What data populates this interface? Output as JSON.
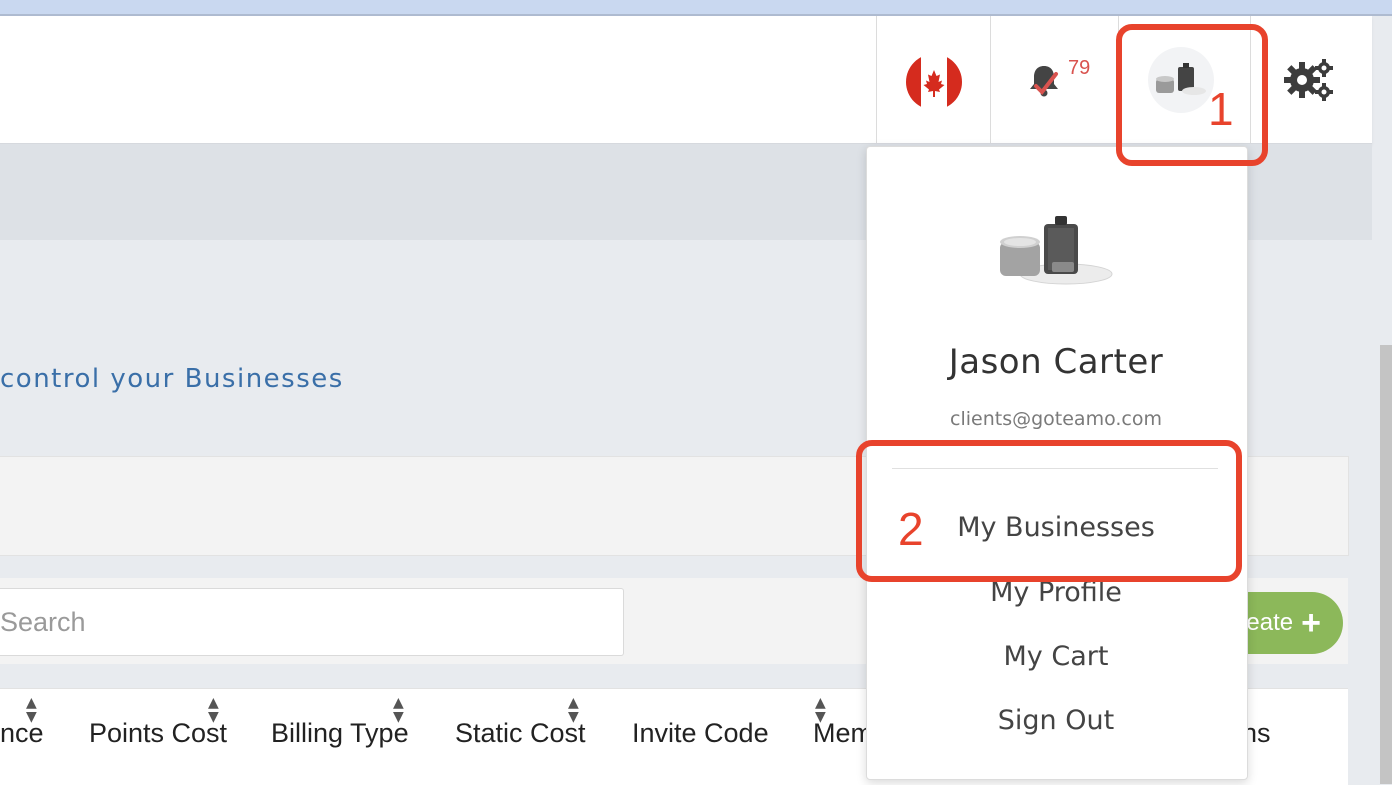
{
  "header": {
    "notification_count": "79",
    "locale_flag": "canada-flag-icon"
  },
  "page": {
    "subtitle": "control your Businesses",
    "search_placeholder": "Search",
    "create_label": "eate"
  },
  "table": {
    "columns": [
      "nce",
      "Points Cost",
      "Billing Type",
      "Static Cost",
      "Invite Code",
      "Mem",
      "ns"
    ]
  },
  "user_menu": {
    "name": "Jason Carter",
    "email": "clients@goteamo.com",
    "items": [
      "My Businesses",
      "My Profile",
      "My Cart",
      "Sign Out"
    ]
  },
  "annotations": {
    "step1": "1",
    "step2": "2",
    "color": "#e8432c"
  },
  "colors": {
    "accent_text": "#3a6fa8",
    "create_button": "#8cb85a",
    "notification": "#d9534f"
  }
}
